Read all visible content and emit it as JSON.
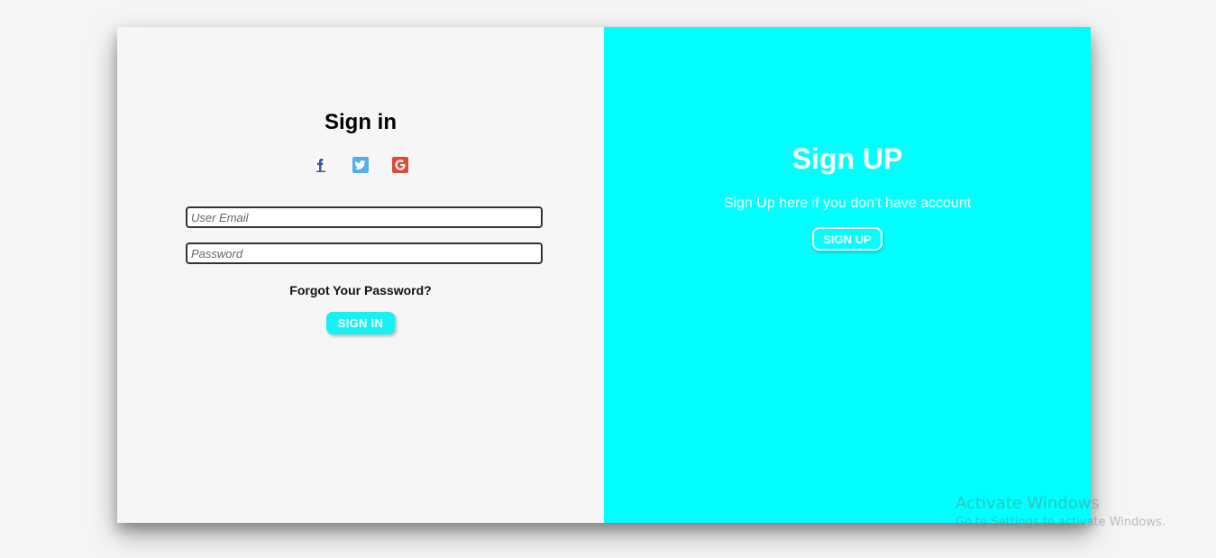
{
  "signin": {
    "title": "Sign in",
    "social": [
      {
        "name": "facebook",
        "icon": "facebook-icon",
        "color": "#3b5998"
      },
      {
        "name": "twitter",
        "icon": "twitter-icon",
        "color": "#55acee"
      },
      {
        "name": "google",
        "icon": "google-plus-icon",
        "color": "#dd4b39"
      }
    ],
    "email_placeholder": "User Email",
    "email_value": "",
    "password_placeholder": "Password",
    "password_value": "",
    "forgot_label": "Forgot Your Password?",
    "button_label": "SIGN IN"
  },
  "signup": {
    "title": "Sign UP",
    "text": "Sign Up here if you don't have account",
    "button_label": "SIGN UP"
  },
  "watermark": {
    "line1": "Activate Windows",
    "line2": "Go to Settings to activate Windows."
  },
  "colors": {
    "accent": "#00ffff",
    "signin_button": "#19f0f2",
    "left_panel": "#f6f6f6"
  }
}
